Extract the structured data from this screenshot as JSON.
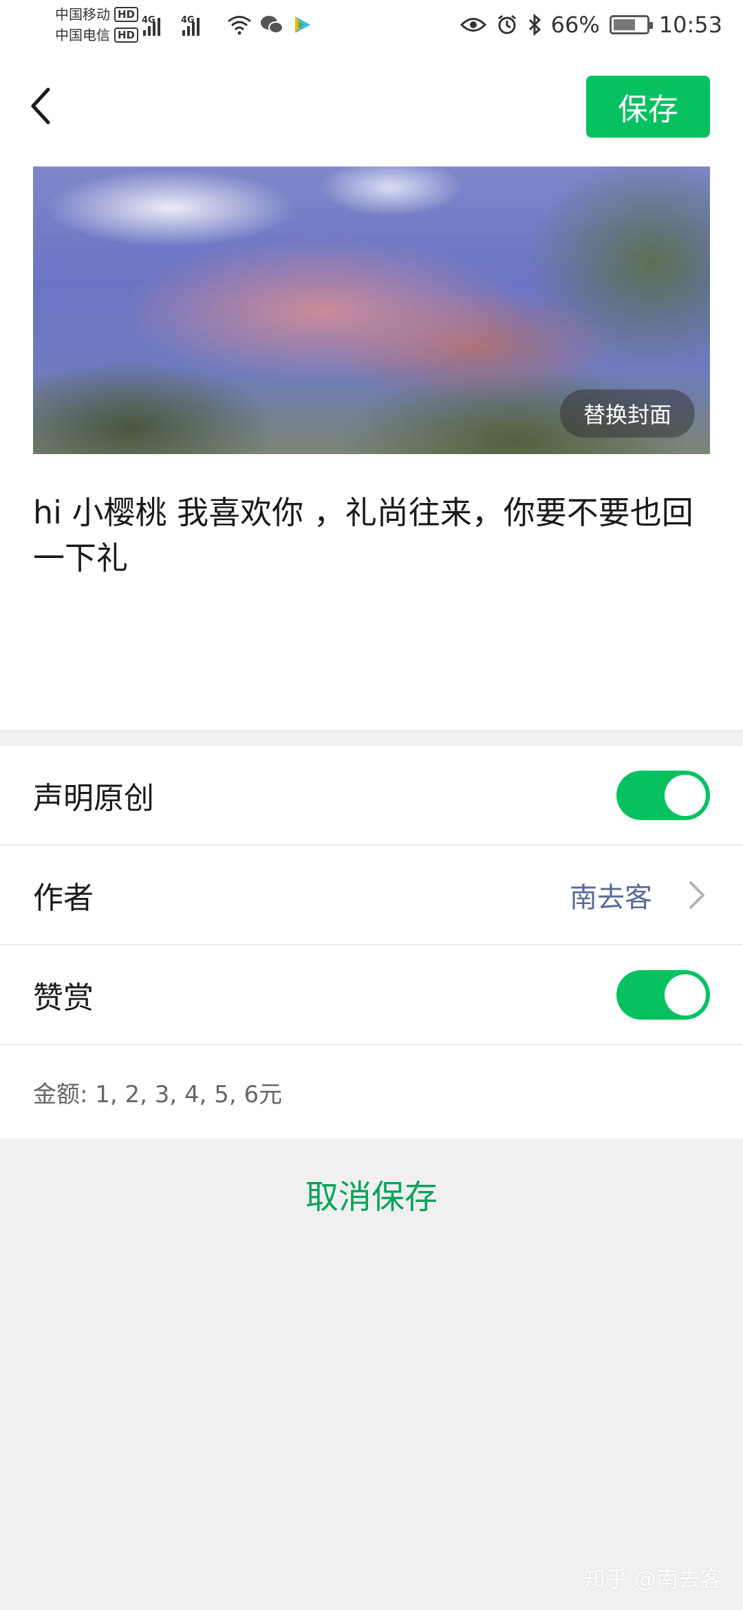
{
  "status_bar": {
    "carrier_1": "中国移动",
    "carrier_2": "中国电信",
    "hd_badge": "HD",
    "network_tag": "4G",
    "battery": "66%",
    "time": "10:53"
  },
  "header": {
    "save_label": "保存"
  },
  "cover": {
    "replace_label": "替换封面"
  },
  "article": {
    "title": "hi 小樱桃 我喜欢你 ，礼尚往来，你要不要也回一下礼"
  },
  "settings": {
    "original_label": "声明原创",
    "original_on": true,
    "author_label": "作者",
    "author_value": "南去客",
    "reward_label": "赞赏",
    "reward_on": true,
    "amount_text": "金额: 1, 2, 3, 4, 5, 6元"
  },
  "footer": {
    "cancel_label": "取消保存",
    "watermark": "知乎 @南去客"
  },
  "colors": {
    "accent": "#07c160",
    "link": "#576b95",
    "cancel": "#07a35a"
  }
}
